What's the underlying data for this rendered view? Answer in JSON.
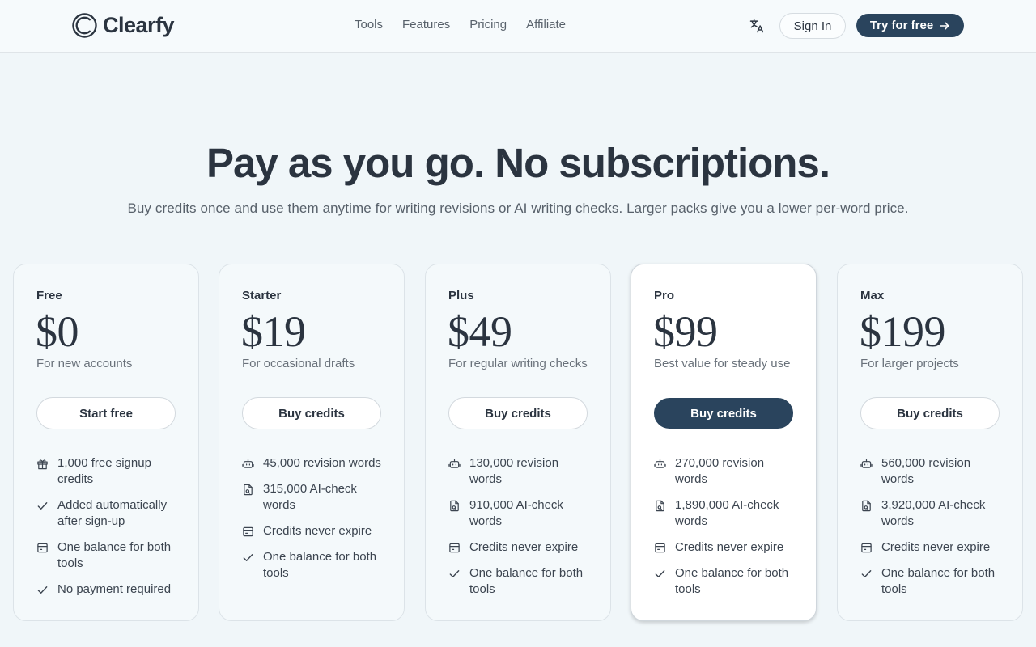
{
  "brand": {
    "name": "Clearfy"
  },
  "nav": {
    "items": [
      {
        "label": "Tools"
      },
      {
        "label": "Features"
      },
      {
        "label": "Pricing"
      },
      {
        "label": "Affiliate"
      }
    ]
  },
  "header": {
    "signin_label": "Sign In",
    "try_label": "Try for free"
  },
  "hero": {
    "title": "Pay as you go. No subscriptions.",
    "subtitle": "Buy credits once and use them anytime for writing revisions or AI writing checks. Larger packs give you a lower per-word price."
  },
  "plans": [
    {
      "name": "Free",
      "price": "$0",
      "description": "For new accounts",
      "button": "Start free",
      "features": [
        {
          "icon": "gift-icon",
          "text": "1,000 free signup credits"
        },
        {
          "icon": "check-icon",
          "text": "Added automatically after sign-up"
        },
        {
          "icon": "wallet-icon",
          "text": "One balance for both tools"
        },
        {
          "icon": "check-icon",
          "text": "No payment required"
        }
      ]
    },
    {
      "name": "Starter",
      "price": "$19",
      "description": "For occasional drafts",
      "button": "Buy credits",
      "features": [
        {
          "icon": "robot-icon",
          "text": "45,000 revision words"
        },
        {
          "icon": "document-search-icon",
          "text": "315,000 AI-check words"
        },
        {
          "icon": "wallet-icon",
          "text": "Credits never expire"
        },
        {
          "icon": "check-icon",
          "text": "One balance for both tools"
        }
      ]
    },
    {
      "name": "Plus",
      "price": "$49",
      "description": "For regular writing checks",
      "button": "Buy credits",
      "features": [
        {
          "icon": "robot-icon",
          "text": "130,000 revision words"
        },
        {
          "icon": "document-search-icon",
          "text": "910,000 AI-check words"
        },
        {
          "icon": "wallet-icon",
          "text": "Credits never expire"
        },
        {
          "icon": "check-icon",
          "text": "One balance for both tools"
        }
      ]
    },
    {
      "name": "Pro",
      "price": "$99",
      "description": "Best value for steady use",
      "button": "Buy credits",
      "featured": true,
      "features": [
        {
          "icon": "robot-icon",
          "text": "270,000 revision words"
        },
        {
          "icon": "document-search-icon",
          "text": "1,890,000 AI-check words"
        },
        {
          "icon": "wallet-icon",
          "text": "Credits never expire"
        },
        {
          "icon": "check-icon",
          "text": "One balance for both tools"
        }
      ]
    },
    {
      "name": "Max",
      "price": "$199",
      "description": "For larger projects",
      "button": "Buy credits",
      "features": [
        {
          "icon": "robot-icon",
          "text": "560,000 revision words"
        },
        {
          "icon": "document-search-icon",
          "text": "3,920,000 AI-check words"
        },
        {
          "icon": "wallet-icon",
          "text": "Credits never expire"
        },
        {
          "icon": "check-icon",
          "text": "One balance for both tools"
        }
      ]
    }
  ],
  "colors": {
    "accent": "#2a445d",
    "background": "#f0f6f9",
    "text": "#2b3440"
  }
}
